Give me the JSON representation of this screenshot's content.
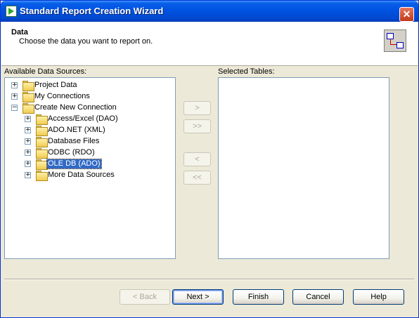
{
  "window": {
    "title": "Standard Report Creation Wizard",
    "close_glyph": "✕"
  },
  "header": {
    "title": "Data",
    "subtitle": "Choose the data you want to report on.",
    "icon": "table-link-icon"
  },
  "available": {
    "label": "Available Data Sources:",
    "items": [
      {
        "label": "Project Data",
        "expander": "+",
        "level": 0,
        "selected": false
      },
      {
        "label": "My Connections",
        "expander": "+",
        "level": 0,
        "selected": false
      },
      {
        "label": "Create New Connection",
        "expander": "−",
        "level": 0,
        "selected": false
      },
      {
        "label": "Access/Excel (DAO)",
        "expander": "+",
        "level": 1,
        "selected": false
      },
      {
        "label": "ADO.NET (XML)",
        "expander": "+",
        "level": 1,
        "selected": false
      },
      {
        "label": "Database Files",
        "expander": "+",
        "level": 1,
        "selected": false
      },
      {
        "label": "ODBC (RDO)",
        "expander": "+",
        "level": 1,
        "selected": false
      },
      {
        "label": "OLE DB (ADO)",
        "expander": "+",
        "level": 1,
        "selected": true
      },
      {
        "label": "More Data Sources",
        "expander": "+",
        "level": 1,
        "selected": false
      }
    ]
  },
  "selected_tables": {
    "label": "Selected Tables:"
  },
  "transfer": {
    "add": ">",
    "add_all": ">>",
    "remove": "<",
    "remove_all": "<<"
  },
  "footer": {
    "back": "< Back",
    "next": "Next >",
    "finish": "Finish",
    "cancel": "Cancel",
    "help": "Help"
  },
  "colors": {
    "title_bar": "#0054e3",
    "selection": "#316ac5",
    "dialog_bg": "#ece9d8"
  }
}
